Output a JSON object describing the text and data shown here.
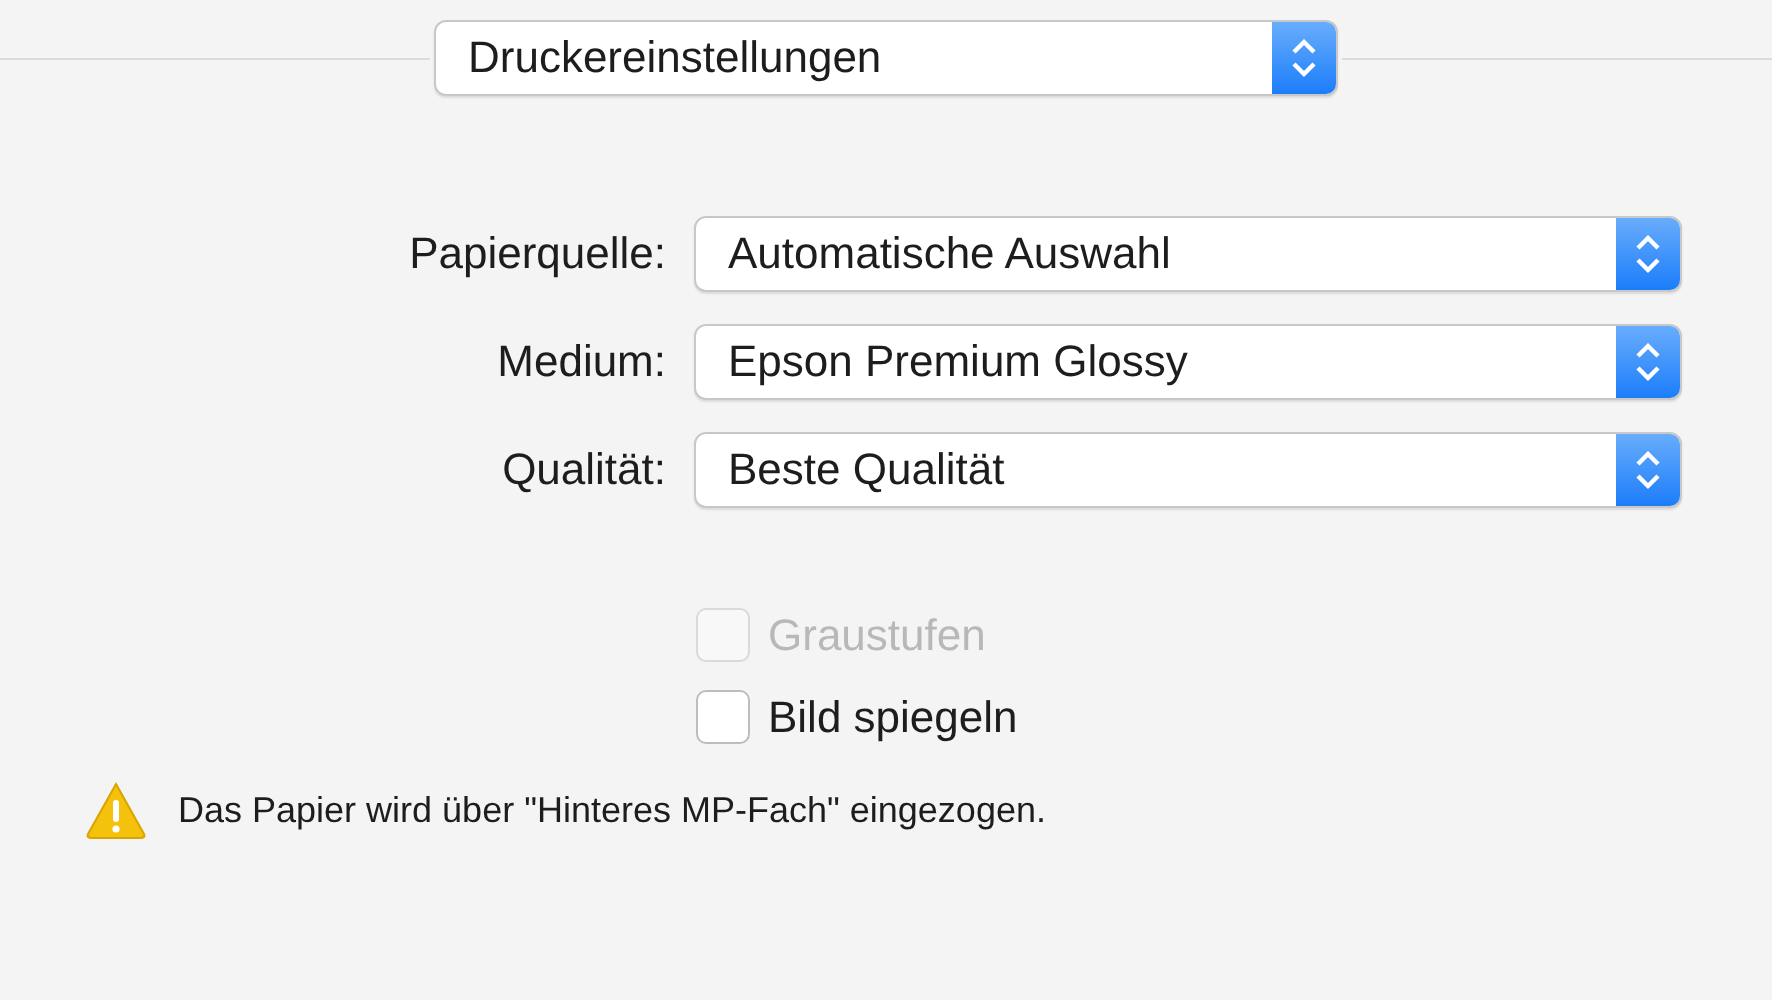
{
  "section_popup": {
    "value": "Druckereinstellungen"
  },
  "settings": [
    {
      "label": "Papierquelle:",
      "value": "Automatische Auswahl"
    },
    {
      "label": "Medium:",
      "value": "Epson Premium Glossy"
    },
    {
      "label": "Qualität:",
      "value": "Beste Qualität"
    }
  ],
  "options": [
    {
      "label": "Graustufen",
      "checked": false,
      "disabled": true
    },
    {
      "label": "Bild spiegeln",
      "checked": false,
      "disabled": false
    }
  ],
  "warning": {
    "text": "Das Papier wird über \"Hinteres MP-Fach\" eingezogen."
  }
}
